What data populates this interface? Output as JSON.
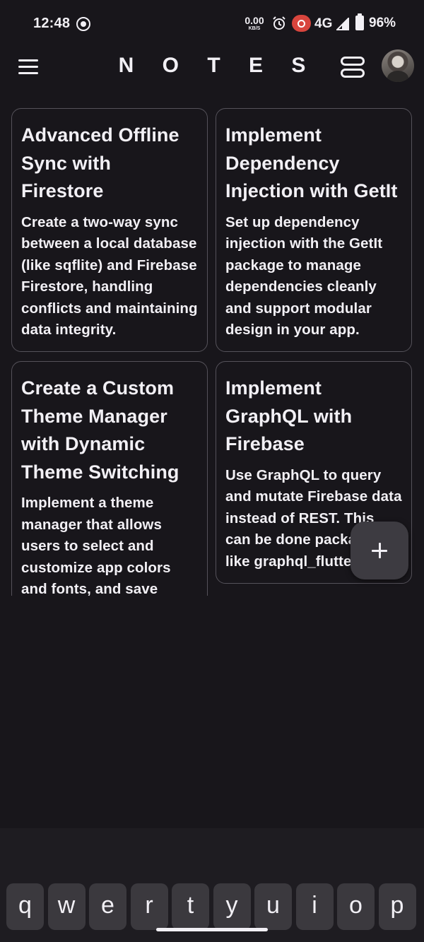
{
  "status_bar": {
    "time": "12:48",
    "net_speed_value": "0.00",
    "net_speed_unit": "KB/S",
    "network_type": "4G",
    "battery": "96%"
  },
  "app_bar": {
    "title": "N O T E S"
  },
  "notes": {
    "left": [
      {
        "title": "Advanced Offline Sync with Firestore",
        "body": "Create a two-way sync between a local database (like sqflite) and Firebase Firestore, handling conflicts and maintaining data integrity."
      },
      {
        "title": "Create a Custom Theme Manager with Dynamic Theme Switching",
        "body": "Implement a theme manager that allows users to select and customize app colors and fonts, and save"
      }
    ],
    "right": [
      {
        "title": "Implement Dependency Injection with GetIt",
        "body": "Set up dependency injection with the GetIt package to manage dependencies cleanly and support modular design in your app."
      },
      {
        "title": "Implement GraphQL with Firebase",
        "body": "Use GraphQL to query and mutate Firebase data instead of REST. This can be done packages like graphql_flutter and"
      }
    ]
  },
  "fab": {
    "icon": "plus-icon"
  },
  "keyboard": {
    "row": [
      "q",
      "w",
      "e",
      "r",
      "t",
      "y",
      "u",
      "i",
      "o",
      "p"
    ]
  },
  "colors": {
    "background": "#18161b",
    "card_border": "#55525a",
    "fab": "#3d3b41",
    "key": "#3b393e",
    "hotspot": "#d8453d"
  }
}
